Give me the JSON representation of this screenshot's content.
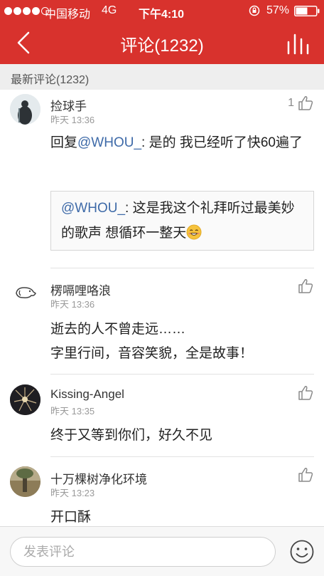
{
  "status_bar": {
    "carrier": "中国移动",
    "network": "4G",
    "time": "下午4:10",
    "battery": "57%",
    "battery_level": 0.57
  },
  "nav": {
    "title": "评论(1232)",
    "back_icon": "chevron-left-icon",
    "chart_icon": "bar-chart-icon"
  },
  "section": {
    "title": "最新评论(1232)"
  },
  "comments": [
    {
      "username": "捡球手",
      "time": "昨天 13:36",
      "likes": "1",
      "reply_prefix": "回复",
      "reply_mention": "@WHOU_",
      "text": ": 是的 我已经听了快60遍了",
      "quote_mention": "@WHOU_",
      "quote_text": ": 这是我这个礼拜听过最美妙的歌声 想循环一整天",
      "quote_emoji": "smile-emoji"
    },
    {
      "username": "楞嗝哩咯浪",
      "time": "昨天 13:36",
      "lines": [
        "逝去的人不曾走远……",
        "字里行间，音容笑貌，全是故事！"
      ]
    },
    {
      "username": "Kissing-Angel",
      "time": "昨天 13:35",
      "text": "终于又等到你们，好久不见"
    },
    {
      "username": "十万棵树净化环境",
      "time": "昨天 13:23",
      "text": "开口酥"
    }
  ],
  "bottom_bar": {
    "placeholder": "发表评论",
    "emoji_icon": "smiley-icon"
  },
  "colors": {
    "brand_red": "#d8322d",
    "mention_blue": "#3e6aa8"
  }
}
